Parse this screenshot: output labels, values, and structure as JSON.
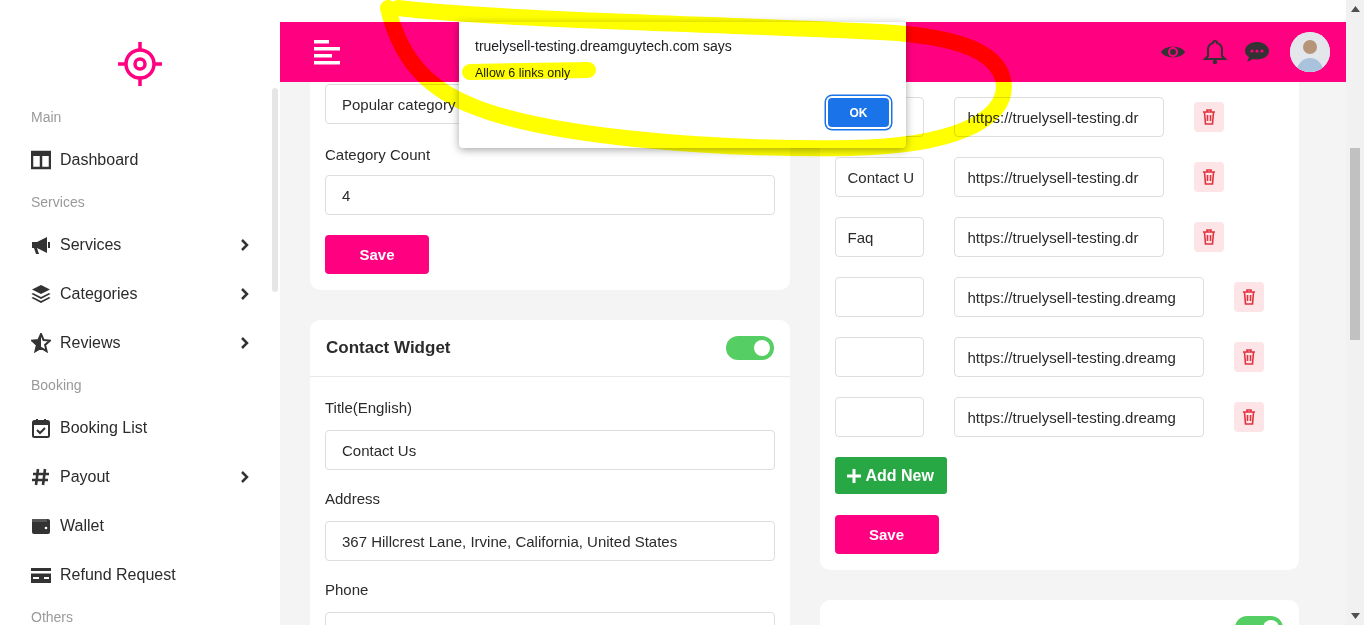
{
  "sidebar": {
    "items": [
      {
        "kind": "section",
        "label": "Main"
      },
      {
        "kind": "link",
        "label": "Dashboard",
        "submenu": false
      },
      {
        "kind": "section",
        "label": "Services"
      },
      {
        "kind": "link",
        "label": "Services",
        "submenu": true
      },
      {
        "kind": "link",
        "label": "Categories",
        "submenu": true
      },
      {
        "kind": "link",
        "label": "Reviews",
        "submenu": true
      },
      {
        "kind": "section",
        "label": "Booking"
      },
      {
        "kind": "link",
        "label": "Booking List",
        "submenu": false
      },
      {
        "kind": "link",
        "label": "Payout",
        "submenu": true
      },
      {
        "kind": "link",
        "label": "Wallet",
        "submenu": false
      },
      {
        "kind": "link",
        "label": "Refund Request",
        "submenu": false
      },
      {
        "kind": "section",
        "label": "Others"
      }
    ]
  },
  "category_widget": {
    "select": {
      "value": "Popular category"
    },
    "fields": [
      {
        "label": "Category Count",
        "value": "4"
      }
    ],
    "save_button": "Save"
  },
  "contact_widget": {
    "title": "Contact Widget",
    "enabled": true,
    "fields": [
      {
        "label": "Title(English)",
        "value": "Contact Us"
      },
      {
        "label": "Address",
        "value": "367 Hillcrest Lane, Irvine, California, United States"
      },
      {
        "label": "Phone"
      }
    ]
  },
  "links_widget": {
    "rows": [
      {
        "kind": "saved",
        "url": "https://truelysell-testing.dr"
      },
      {
        "kind": "saved",
        "name": "Contact U",
        "url": "https://truelysell-testing.dr"
      },
      {
        "kind": "saved",
        "name": "Faq",
        "url": "https://truelysell-testing.dr"
      },
      {
        "kind": "new",
        "url": "https://truelysell-testing.dreamg"
      },
      {
        "kind": "new",
        "url": "https://truelysell-testing.dreamg"
      },
      {
        "kind": "new",
        "url": "https://truelysell-testing.dreamg"
      }
    ],
    "add_button": "Add New",
    "save_button": "Save"
  },
  "social_widget": {
    "enabled": true
  },
  "dialog": {
    "title": "truelysell-testing.dreamguytech.com says",
    "message": "Allow 6 links only",
    "button": "OK"
  },
  "annotation": {
    "kind": "highlighter",
    "color": "#ffff00"
  }
}
